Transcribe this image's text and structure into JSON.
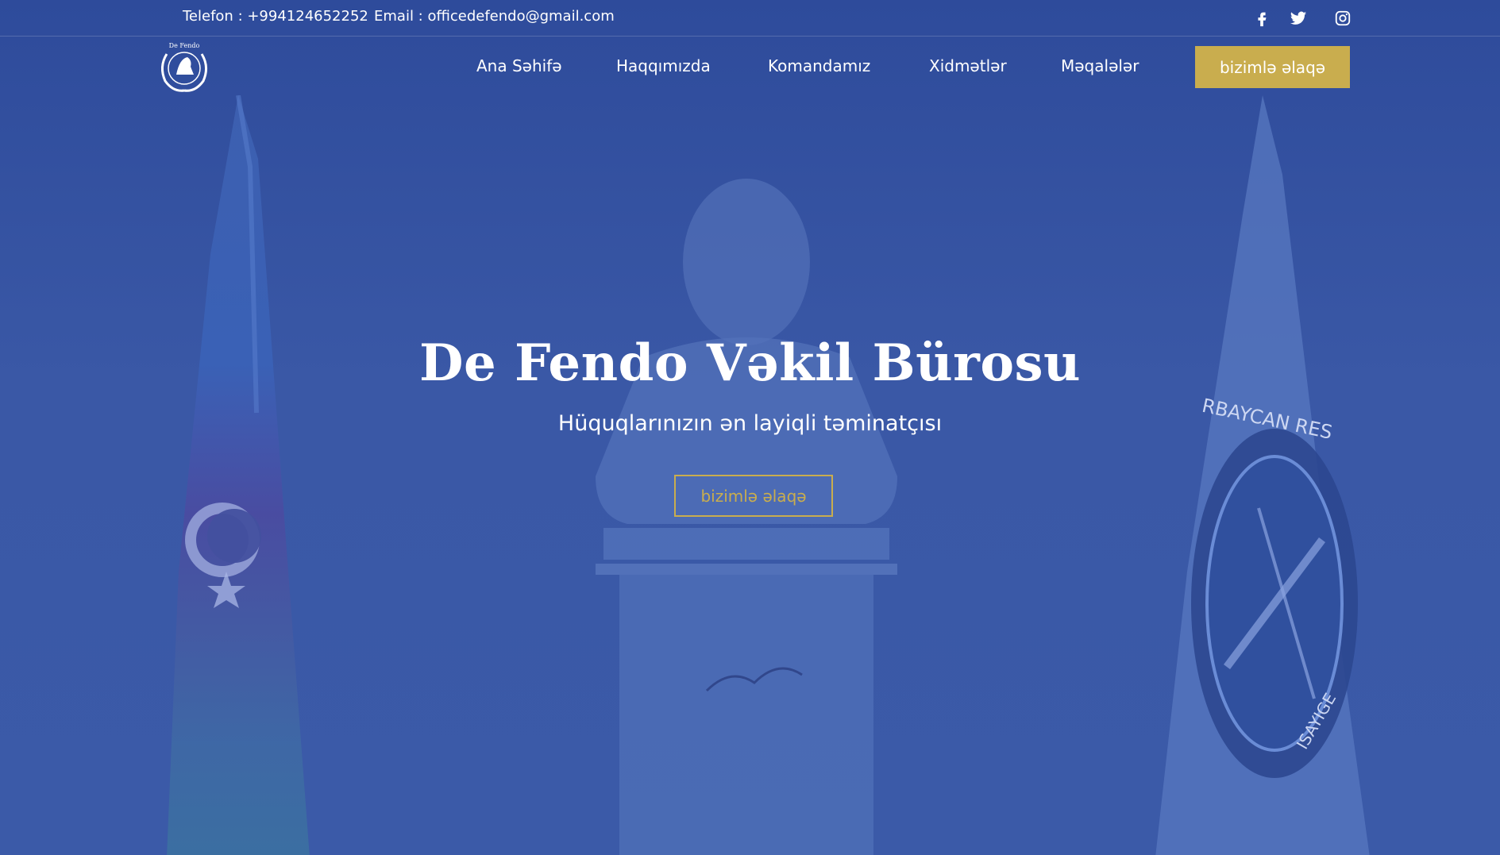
{
  "topbar": {
    "phone": "Telefon : +994124652252",
    "email": "Email : officedefendo@gmail.com",
    "social": [
      "facebook-icon",
      "twitter-icon",
      "instagram-icon"
    ]
  },
  "logo": {
    "text": "De Fendo"
  },
  "nav": {
    "items": [
      "Ana Səhifə",
      "Haqqımızda",
      "Komandamız",
      "Xidmətlər",
      "Məqalələr"
    ],
    "cta": "bizimlə əlaqə"
  },
  "hero": {
    "title": "De Fendo Vəkil Bürosu",
    "subtitle": "Hüquqlarınızın ən layiqli təminatçısı",
    "button": "bizimlə əlaqə",
    "emblem_text": "RBAYCAN RES",
    "emblem_text2": "ISAYIGE"
  },
  "colors": {
    "overlay": "#2f4d9c",
    "accent": "#c9ad4e",
    "text": "#ffffff"
  }
}
